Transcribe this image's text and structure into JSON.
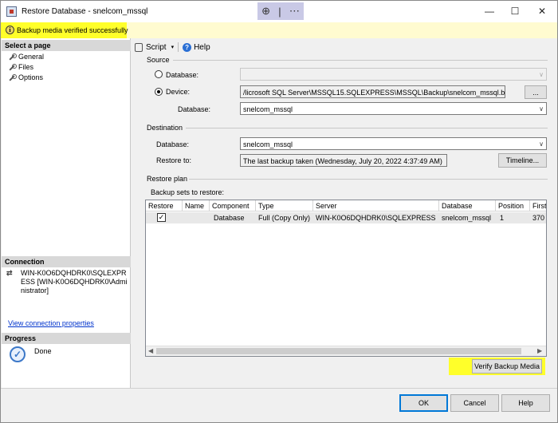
{
  "window": {
    "title": "Restore Database - snelcom_mssql",
    "zoom_icon": "magnifier-icon",
    "minimize": "—",
    "maximize": "☐",
    "close": "✕",
    "overflow": "⋯"
  },
  "infobar": {
    "message": "Backup media verified successfully",
    "highlight_color": "#ffff2a"
  },
  "left": {
    "select_page_header": "Select a page",
    "pages": [
      "General",
      "Files",
      "Options"
    ],
    "connection_header": "Connection",
    "connection_text": "WIN-K0O6DQHDRK0\\SQLEXPRESS [WIN-K0O6DQHDRK0\\Administrator]",
    "view_connection_link": "View connection properties",
    "progress_header": "Progress",
    "progress_status": "Done"
  },
  "toolbar": {
    "script_label": "Script",
    "help_label": "Help"
  },
  "source": {
    "section_label": "Source",
    "database_radio_label": "Database:",
    "database_combo_value": "",
    "device_radio_label": "Device:",
    "device_path": "/licrosoft SQL Server\\MSSQL15.SQLEXPRESS\\MSSQL\\Backup\\snelcom_mssql.bak",
    "browse_label": "...",
    "database_label": "Database:",
    "database_value": "snelcom_mssql",
    "selected": "Device"
  },
  "destination": {
    "section_label": "Destination",
    "database_label": "Database:",
    "database_value": "snelcom_mssql",
    "restore_to_label": "Restore to:",
    "restore_to_value": "The last backup taken (Wednesday, July 20, 2022 4:37:49 AM)",
    "timeline_label": "Timeline..."
  },
  "restore_plan": {
    "section_label": "Restore plan",
    "backup_sets_label": "Backup sets to restore:",
    "columns": [
      "Restore",
      "Name",
      "Component",
      "Type",
      "Server",
      "Database",
      "Position",
      "First"
    ],
    "rows": [
      {
        "restore": "✓",
        "name": "",
        "component": "Database",
        "type": "Full (Copy Only)",
        "server": "WIN-K0O6DQHDRK0\\SQLEXPRESS",
        "database": "snelcom_mssql",
        "position": "1",
        "first": "370"
      }
    ],
    "verify_label": "Verify Backup Media"
  },
  "buttons": {
    "ok": "OK",
    "cancel": "Cancel",
    "help": "Help"
  }
}
